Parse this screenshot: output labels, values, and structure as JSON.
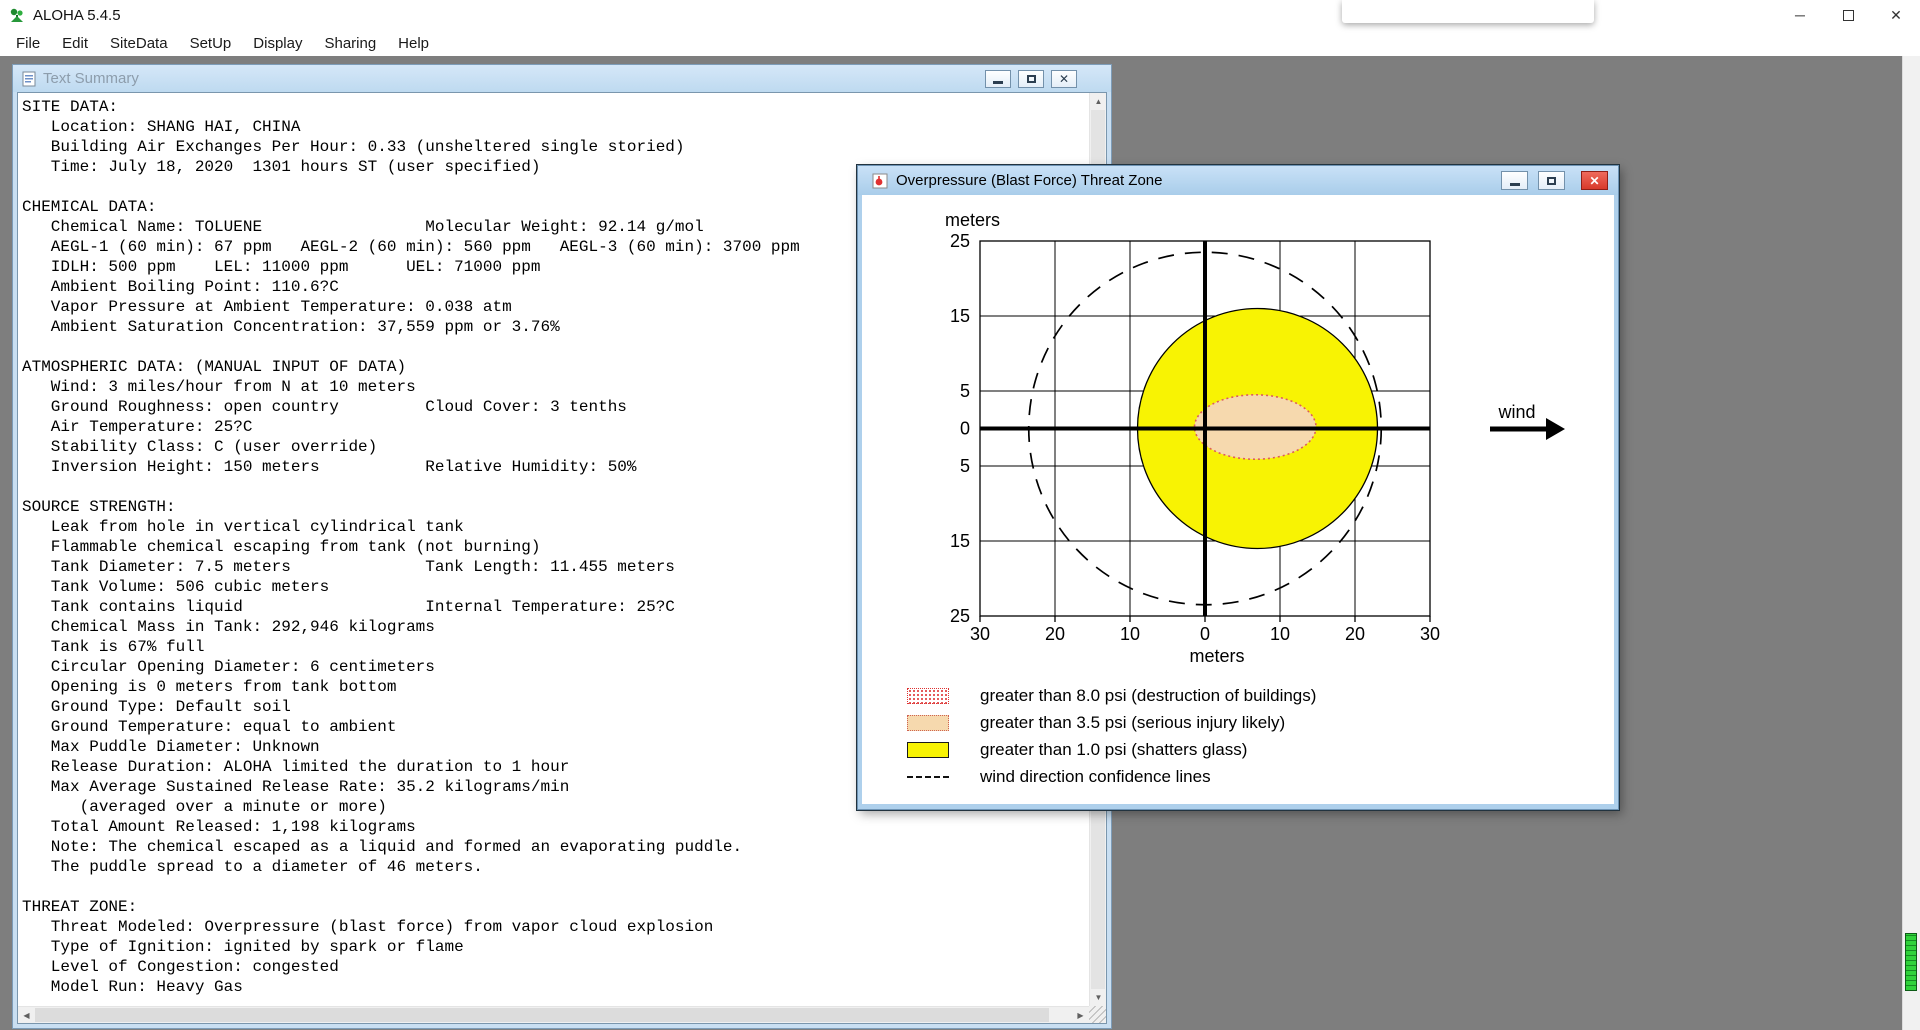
{
  "app": {
    "title": "ALOHA 5.4.5",
    "menu_items": [
      "File",
      "Edit",
      "SiteData",
      "SetUp",
      "Display",
      "Sharing",
      "Help"
    ]
  },
  "icons": {
    "app_minimize": "─",
    "app_close": "✕",
    "mdi_close": "✕",
    "scroll_up": "▲",
    "scroll_down": "▼",
    "scroll_left": "◀",
    "scroll_right": "▶"
  },
  "text_summary_window": {
    "title": "Text Summary",
    "report_lines": [
      "SITE DATA:",
      "   Location: SHANG HAI, CHINA",
      "   Building Air Exchanges Per Hour: 0.33 (unsheltered single storied)",
      "   Time: July 18, 2020  1301 hours ST (user specified)",
      "",
      "CHEMICAL DATA:",
      "   Chemical Name: TOLUENE                 Molecular Weight: 92.14 g/mol",
      "   AEGL-1 (60 min): 67 ppm   AEGL-2 (60 min): 560 ppm   AEGL-3 (60 min): 3700 ppm",
      "   IDLH: 500 ppm    LEL: 11000 ppm      UEL: 71000 ppm",
      "   Ambient Boiling Point: 110.6?C",
      "   Vapor Pressure at Ambient Temperature: 0.038 atm",
      "   Ambient Saturation Concentration: 37,559 ppm or 3.76%",
      "",
      "ATMOSPHERIC DATA: (MANUAL INPUT OF DATA)",
      "   Wind: 3 miles/hour from N at 10 meters",
      "   Ground Roughness: open country         Cloud Cover: 3 tenths",
      "   Air Temperature: 25?C",
      "   Stability Class: C (user override)",
      "   Inversion Height: 150 meters           Relative Humidity: 50%",
      "",
      "SOURCE STRENGTH:",
      "   Leak from hole in vertical cylindrical tank",
      "   Flammable chemical escaping from tank (not burning)",
      "   Tank Diameter: 7.5 meters              Tank Length: 11.455 meters",
      "   Tank Volume: 506 cubic meters",
      "   Tank contains liquid                   Internal Temperature: 25?C",
      "   Chemical Mass in Tank: 292,946 kilograms",
      "   Tank is 67% full",
      "   Circular Opening Diameter: 6 centimeters",
      "   Opening is 0 meters from tank bottom",
      "   Ground Type: Default soil",
      "   Ground Temperature: equal to ambient",
      "   Max Puddle Diameter: Unknown",
      "   Release Duration: ALOHA limited the duration to 1 hour",
      "   Max Average Sustained Release Rate: 35.2 kilograms/min",
      "      (averaged over a minute or more)",
      "   Total Amount Released: 1,198 kilograms",
      "   Note: The chemical escaped as a liquid and formed an evaporating puddle.",
      "   The puddle spread to a diameter of 46 meters.",
      "",
      "THREAT ZONE:",
      "   Threat Modeled: Overpressure (blast force) from vapor cloud explosion",
      "   Type of Ignition: ignited by spark or flame",
      "   Level of Congestion: congested",
      "   Model Run: Heavy Gas"
    ]
  },
  "threat_window": {
    "title": "Overpressure (Blast Force) Threat Zone",
    "wind_label": "wind",
    "legend": [
      {
        "style": "red-hatch",
        "label": "greater than 8.0 psi (destruction of buildings)"
      },
      {
        "style": "orange-fill",
        "label": "greater than 3.5 psi (serious injury likely)"
      },
      {
        "style": "yellow-fill",
        "label": "greater than 1.0 psi (shatters glass)"
      },
      {
        "style": "dashed-line",
        "label": "wind direction confidence lines"
      }
    ],
    "chart_data": {
      "type": "area",
      "title": "Overpressure (Blast Force) Threat Zone",
      "xlabel": "meters",
      "ylabel": "meters",
      "xlim": [
        -30,
        30
      ],
      "ylim": [
        -25,
        25
      ],
      "grid": true,
      "x_grid_m": [
        -30,
        -20,
        -10,
        0,
        10,
        20,
        30
      ],
      "y_grid_m": [
        -25,
        -15,
        -5,
        5,
        15,
        25
      ],
      "x_tick_values": [
        -30,
        -20,
        -10,
        0,
        10,
        20,
        30
      ],
      "x_tick_labels": [
        "30",
        "20",
        "10",
        "0",
        "10",
        "20",
        "30"
      ],
      "y_tick_values": [
        25,
        15,
        5,
        0,
        -5,
        -15,
        -25
      ],
      "y_tick_labels": [
        "25",
        "15",
        "5",
        "0",
        "5",
        "15",
        "25"
      ],
      "zones": [
        {
          "name": "greater than 1.0 psi (shatters glass)",
          "shape": "circle",
          "center_m": [
            7,
            0
          ],
          "radius_m": 16,
          "fill": "#f8f303",
          "stroke": "#000000"
        },
        {
          "name": "greater than 3.5 psi (serious injury likely)",
          "shape": "ellipse",
          "center_m": [
            6.7,
            0.2
          ],
          "rx_m": 8.1,
          "ry_m": 4.3,
          "fill": "#f6d9ae",
          "stroke": "#dd5c5c"
        }
      ],
      "confidence_circle": {
        "name": "wind direction confidence lines",
        "shape": "dashed-circle",
        "center_m": [
          0,
          0
        ],
        "radius_m": 23.5
      },
      "wind_direction": "arrow points right (downwind to the east of origin)"
    }
  },
  "colors": {
    "desktop_background": "#7e7e7e",
    "titlebar_background": "#ffffff",
    "child_frame_inactive": "#c9dff2",
    "child_frame_active": "#aed0ec",
    "inactive_title_text": "#8d9dac",
    "close_button_red": "#d83a2b",
    "zone_yellow": "#f8f303",
    "zone_orange": "#f6d9ae",
    "zone_red": "#dd3232",
    "level_meter_green": "#2fd23a"
  }
}
